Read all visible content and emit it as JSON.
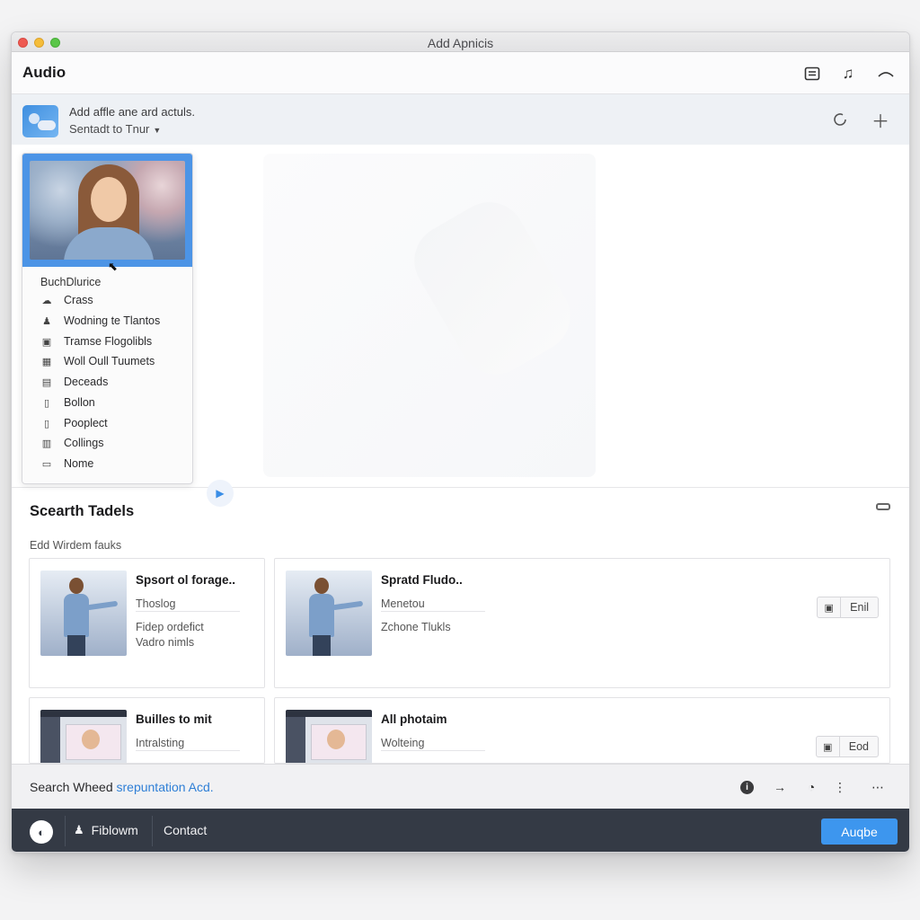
{
  "window": {
    "title": "Add Apnicis"
  },
  "header": {
    "title": "Audio",
    "icons": [
      "inbox-icon",
      "music-note-icon",
      "chevron-up-icon"
    ]
  },
  "account": {
    "line1": "Add affle ane ard actuls.",
    "line2": "Sentadt to Tnur",
    "icons": [
      "refresh-icon",
      "plus-icon"
    ]
  },
  "dropdown": {
    "heading": "BuchDlurice",
    "items": [
      {
        "label": "Crass",
        "icon": "cloud-icon"
      },
      {
        "label": "Wodning te Tlantos",
        "icon": "person-icon"
      },
      {
        "label": "Tramse Flogolibls",
        "icon": "image-icon"
      },
      {
        "label": "Woll Oull Tuumets",
        "icon": "calendar-icon"
      },
      {
        "label": "Deceads",
        "icon": "document-icon"
      },
      {
        "label": "Bollon",
        "icon": "file-icon"
      },
      {
        "label": "Pooplect",
        "icon": "file-icon"
      },
      {
        "label": "Collings",
        "icon": "document-icon"
      },
      {
        "label": "Nome",
        "icon": "monitor-icon"
      }
    ]
  },
  "section": {
    "title": "Scearth Tadels",
    "subtitle": "Edd Wirdem fauks",
    "cards": [
      {
        "title": "Spsort ol forage..",
        "line1": "Thoslog",
        "line2": "Fidep ordefict",
        "line3": "Vadro nimls",
        "action": ""
      },
      {
        "title": "Spratd Fludo..",
        "line1": "Menetou",
        "line2": "Zchone Tlukls",
        "line3": "",
        "action": "Enil"
      },
      {
        "title": "Builles to mit",
        "line1": "Intralsting",
        "line2": "",
        "line3": "",
        "action": ""
      },
      {
        "title": "All photaim",
        "line1": "Wolteing",
        "line2": "",
        "line3": "",
        "action": "Eod"
      }
    ]
  },
  "searchbar": {
    "label": "Search Wheed",
    "link": "srepuntation Acd."
  },
  "bottomnav": {
    "item1": "Fiblowm",
    "item2": "Contact",
    "primary": "Auqbe"
  }
}
